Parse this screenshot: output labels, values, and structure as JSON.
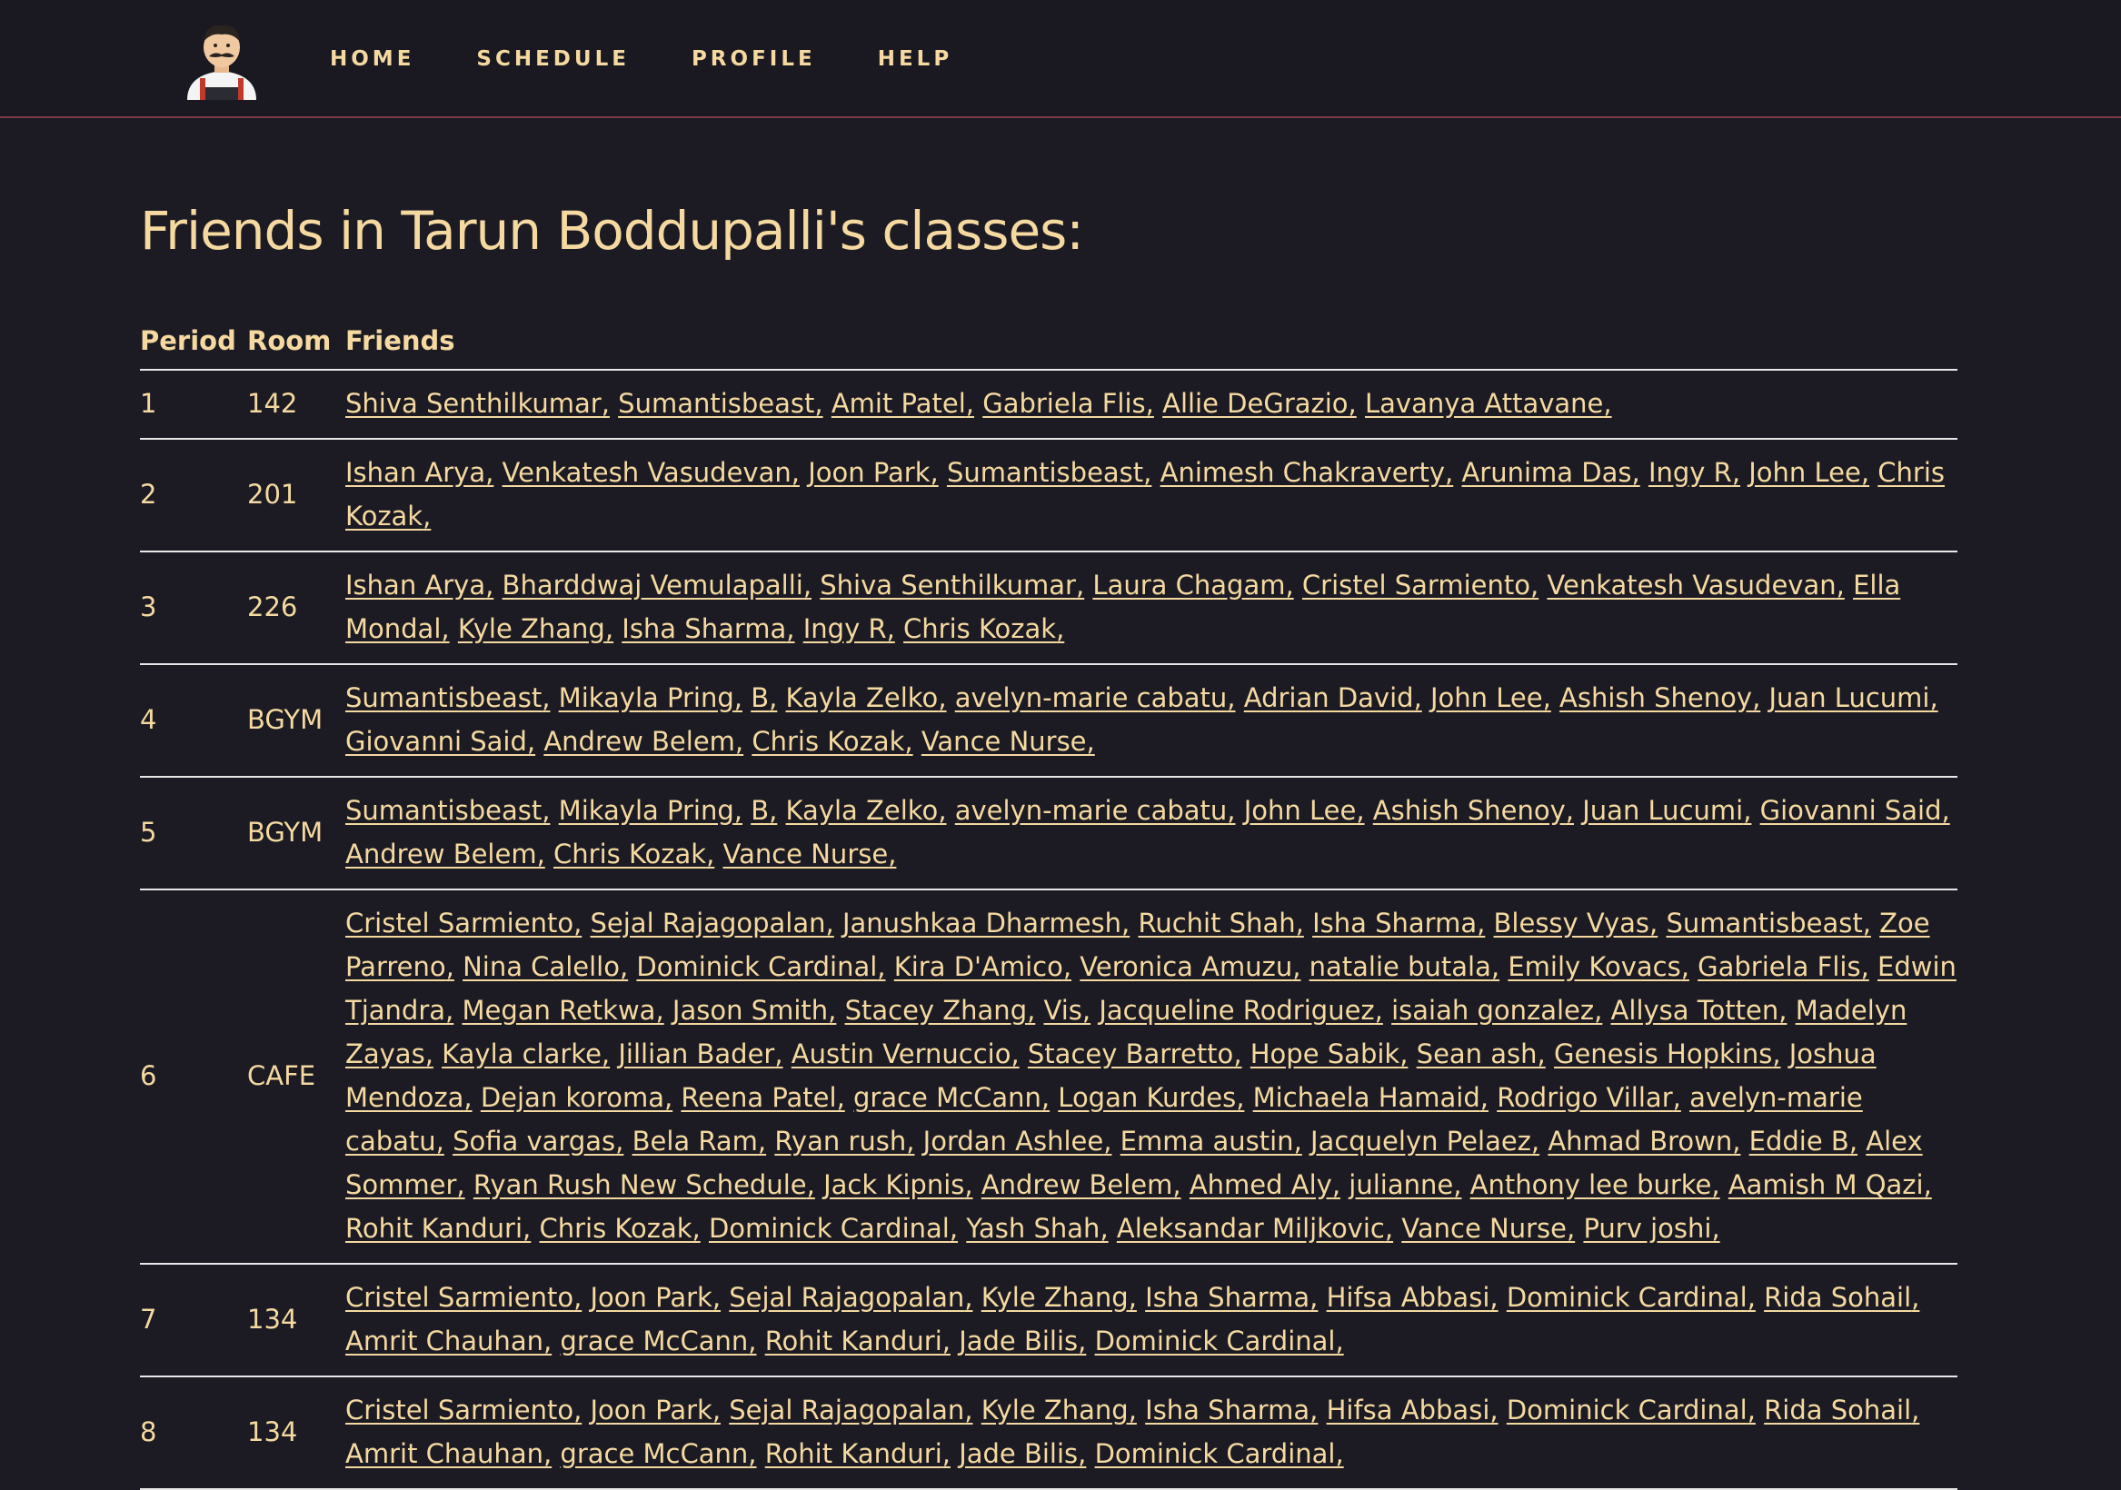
{
  "nav": {
    "items": [
      "HOME",
      "SCHEDULE",
      "PROFILE",
      "HELP"
    ]
  },
  "page_title": "Friends in Tarun Boddupalli's classes:",
  "table": {
    "headers": [
      "Period",
      "Room",
      "Friends"
    ],
    "rows": [
      {
        "period": "1",
        "room": "142",
        "friends": [
          "Shiva Senthilkumar",
          "Sumantisbeast",
          "Amit Patel",
          "Gabriela Flis",
          "Allie DeGrazio",
          "Lavanya Attavane"
        ]
      },
      {
        "period": "2",
        "room": "201",
        "friends": [
          "Ishan Arya",
          "Venkatesh Vasudevan",
          "Joon Park",
          "Sumantisbeast",
          "Animesh Chakraverty",
          "Arunima Das",
          "Ingy R",
          "John Lee",
          "Chris Kozak"
        ]
      },
      {
        "period": "3",
        "room": "226",
        "friends": [
          "Ishan Arya",
          "Bharddwaj Vemulapalli",
          "Shiva Senthilkumar",
          "Laura Chagam",
          "Cristel Sarmiento",
          "Venkatesh Vasudevan",
          "Ella Mondal",
          "Kyle Zhang",
          "Isha Sharma",
          "Ingy R",
          "Chris Kozak"
        ]
      },
      {
        "period": "4",
        "room": "BGYM",
        "friends": [
          "Sumantisbeast",
          "Mikayla Pring",
          "B",
          "Kayla Zelko",
          "avelyn-marie cabatu",
          "Adrian David",
          "John Lee",
          "Ashish Shenoy",
          "Juan Lucumi",
          "Giovanni Said",
          "Andrew Belem",
          "Chris Kozak",
          "Vance Nurse"
        ]
      },
      {
        "period": "5",
        "room": "BGYM",
        "friends": [
          "Sumantisbeast",
          "Mikayla Pring",
          "B",
          "Kayla Zelko",
          "avelyn-marie cabatu",
          "John Lee",
          "Ashish Shenoy",
          "Juan Lucumi",
          "Giovanni Said",
          "Andrew Belem",
          "Chris Kozak",
          "Vance Nurse"
        ]
      },
      {
        "period": "6",
        "room": "CAFE",
        "friends": [
          "Cristel Sarmiento",
          "Sejal Rajagopalan",
          "Janushkaa Dharmesh",
          "Ruchit Shah",
          "Isha Sharma",
          "Blessy Vyas",
          "Sumantisbeast",
          "Zoe Parreno",
          "Nina Calello",
          "Dominick Cardinal",
          "Kira D'Amico",
          "Veronica Amuzu",
          "natalie butala",
          "Emily Kovacs",
          "Gabriela Flis",
          "Edwin Tjandra",
          "Megan Retkwa",
          "Jason Smith",
          "Stacey Zhang",
          "Vis",
          "Jacqueline Rodriguez",
          "isaiah gonzalez",
          "Allysa Totten",
          "Madelyn Zayas",
          "Kayla clarke",
          "Jillian Bader",
          "Austin Vernuccio",
          "Stacey Barretto",
          "Hope Sabik",
          "Sean ash",
          "Genesis Hopkins",
          "Joshua Mendoza",
          "Dejan koroma",
          "Reena Patel",
          "grace McCann",
          "Logan Kurdes",
          "Michaela Hamaid",
          "Rodrigo Villar",
          "avelyn-marie cabatu",
          "Sofia vargas",
          "Bela Ram",
          "Ryan rush",
          "Jordan Ashlee",
          "Emma austin",
          "Jacquelyn Pelaez",
          "Ahmad Brown",
          "Eddie B",
          "Alex Sommer",
          "Ryan Rush New Schedule",
          "Jack Kipnis",
          "Andrew Belem",
          "Ahmed Aly",
          "julianne",
          "Anthony lee burke",
          "Aamish M Qazi",
          "Rohit Kanduri",
          "Chris Kozak",
          "Dominick Cardinal",
          "Yash Shah",
          "Aleksandar Miljkovic",
          "Vance Nurse",
          "Purv joshi"
        ]
      },
      {
        "period": "7",
        "room": "134",
        "friends": [
          "Cristel Sarmiento",
          "Joon Park",
          "Sejal Rajagopalan",
          "Kyle Zhang",
          "Isha Sharma",
          "Hifsa Abbasi",
          "Dominick Cardinal",
          "Rida Sohail",
          "Amrit Chauhan",
          "grace McCann",
          "Rohit Kanduri",
          "Jade Bilis",
          "Dominick Cardinal"
        ]
      },
      {
        "period": "8",
        "room": "134",
        "friends": [
          "Cristel Sarmiento",
          "Joon Park",
          "Sejal Rajagopalan",
          "Kyle Zhang",
          "Isha Sharma",
          "Hifsa Abbasi",
          "Dominick Cardinal",
          "Rida Sohail",
          "Amrit Chauhan",
          "grace McCann",
          "Rohit Kanduri",
          "Jade Bilis",
          "Dominick Cardinal"
        ]
      }
    ]
  }
}
